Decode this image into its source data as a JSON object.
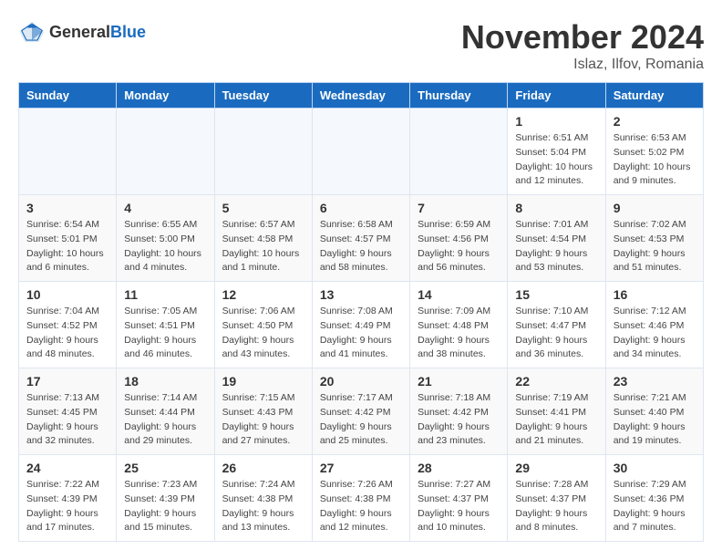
{
  "header": {
    "logo_general": "General",
    "logo_blue": "Blue",
    "month_title": "November 2024",
    "location": "Islaz, Ilfov, Romania"
  },
  "weekdays": [
    "Sunday",
    "Monday",
    "Tuesday",
    "Wednesday",
    "Thursday",
    "Friday",
    "Saturday"
  ],
  "weeks": [
    [
      {
        "day": "",
        "empty": true
      },
      {
        "day": "",
        "empty": true
      },
      {
        "day": "",
        "empty": true
      },
      {
        "day": "",
        "empty": true
      },
      {
        "day": "",
        "empty": true
      },
      {
        "day": "1",
        "sunrise": "Sunrise: 6:51 AM",
        "sunset": "Sunset: 5:04 PM",
        "daylight": "Daylight: 10 hours and 12 minutes."
      },
      {
        "day": "2",
        "sunrise": "Sunrise: 6:53 AM",
        "sunset": "Sunset: 5:02 PM",
        "daylight": "Daylight: 10 hours and 9 minutes."
      }
    ],
    [
      {
        "day": "3",
        "sunrise": "Sunrise: 6:54 AM",
        "sunset": "Sunset: 5:01 PM",
        "daylight": "Daylight: 10 hours and 6 minutes."
      },
      {
        "day": "4",
        "sunrise": "Sunrise: 6:55 AM",
        "sunset": "Sunset: 5:00 PM",
        "daylight": "Daylight: 10 hours and 4 minutes."
      },
      {
        "day": "5",
        "sunrise": "Sunrise: 6:57 AM",
        "sunset": "Sunset: 4:58 PM",
        "daylight": "Daylight: 10 hours and 1 minute."
      },
      {
        "day": "6",
        "sunrise": "Sunrise: 6:58 AM",
        "sunset": "Sunset: 4:57 PM",
        "daylight": "Daylight: 9 hours and 58 minutes."
      },
      {
        "day": "7",
        "sunrise": "Sunrise: 6:59 AM",
        "sunset": "Sunset: 4:56 PM",
        "daylight": "Daylight: 9 hours and 56 minutes."
      },
      {
        "day": "8",
        "sunrise": "Sunrise: 7:01 AM",
        "sunset": "Sunset: 4:54 PM",
        "daylight": "Daylight: 9 hours and 53 minutes."
      },
      {
        "day": "9",
        "sunrise": "Sunrise: 7:02 AM",
        "sunset": "Sunset: 4:53 PM",
        "daylight": "Daylight: 9 hours and 51 minutes."
      }
    ],
    [
      {
        "day": "10",
        "sunrise": "Sunrise: 7:04 AM",
        "sunset": "Sunset: 4:52 PM",
        "daylight": "Daylight: 9 hours and 48 minutes."
      },
      {
        "day": "11",
        "sunrise": "Sunrise: 7:05 AM",
        "sunset": "Sunset: 4:51 PM",
        "daylight": "Daylight: 9 hours and 46 minutes."
      },
      {
        "day": "12",
        "sunrise": "Sunrise: 7:06 AM",
        "sunset": "Sunset: 4:50 PM",
        "daylight": "Daylight: 9 hours and 43 minutes."
      },
      {
        "day": "13",
        "sunrise": "Sunrise: 7:08 AM",
        "sunset": "Sunset: 4:49 PM",
        "daylight": "Daylight: 9 hours and 41 minutes."
      },
      {
        "day": "14",
        "sunrise": "Sunrise: 7:09 AM",
        "sunset": "Sunset: 4:48 PM",
        "daylight": "Daylight: 9 hours and 38 minutes."
      },
      {
        "day": "15",
        "sunrise": "Sunrise: 7:10 AM",
        "sunset": "Sunset: 4:47 PM",
        "daylight": "Daylight: 9 hours and 36 minutes."
      },
      {
        "day": "16",
        "sunrise": "Sunrise: 7:12 AM",
        "sunset": "Sunset: 4:46 PM",
        "daylight": "Daylight: 9 hours and 34 minutes."
      }
    ],
    [
      {
        "day": "17",
        "sunrise": "Sunrise: 7:13 AM",
        "sunset": "Sunset: 4:45 PM",
        "daylight": "Daylight: 9 hours and 32 minutes."
      },
      {
        "day": "18",
        "sunrise": "Sunrise: 7:14 AM",
        "sunset": "Sunset: 4:44 PM",
        "daylight": "Daylight: 9 hours and 29 minutes."
      },
      {
        "day": "19",
        "sunrise": "Sunrise: 7:15 AM",
        "sunset": "Sunset: 4:43 PM",
        "daylight": "Daylight: 9 hours and 27 minutes."
      },
      {
        "day": "20",
        "sunrise": "Sunrise: 7:17 AM",
        "sunset": "Sunset: 4:42 PM",
        "daylight": "Daylight: 9 hours and 25 minutes."
      },
      {
        "day": "21",
        "sunrise": "Sunrise: 7:18 AM",
        "sunset": "Sunset: 4:42 PM",
        "daylight": "Daylight: 9 hours and 23 minutes."
      },
      {
        "day": "22",
        "sunrise": "Sunrise: 7:19 AM",
        "sunset": "Sunset: 4:41 PM",
        "daylight": "Daylight: 9 hours and 21 minutes."
      },
      {
        "day": "23",
        "sunrise": "Sunrise: 7:21 AM",
        "sunset": "Sunset: 4:40 PM",
        "daylight": "Daylight: 9 hours and 19 minutes."
      }
    ],
    [
      {
        "day": "24",
        "sunrise": "Sunrise: 7:22 AM",
        "sunset": "Sunset: 4:39 PM",
        "daylight": "Daylight: 9 hours and 17 minutes."
      },
      {
        "day": "25",
        "sunrise": "Sunrise: 7:23 AM",
        "sunset": "Sunset: 4:39 PM",
        "daylight": "Daylight: 9 hours and 15 minutes."
      },
      {
        "day": "26",
        "sunrise": "Sunrise: 7:24 AM",
        "sunset": "Sunset: 4:38 PM",
        "daylight": "Daylight: 9 hours and 13 minutes."
      },
      {
        "day": "27",
        "sunrise": "Sunrise: 7:26 AM",
        "sunset": "Sunset: 4:38 PM",
        "daylight": "Daylight: 9 hours and 12 minutes."
      },
      {
        "day": "28",
        "sunrise": "Sunrise: 7:27 AM",
        "sunset": "Sunset: 4:37 PM",
        "daylight": "Daylight: 9 hours and 10 minutes."
      },
      {
        "day": "29",
        "sunrise": "Sunrise: 7:28 AM",
        "sunset": "Sunset: 4:37 PM",
        "daylight": "Daylight: 9 hours and 8 minutes."
      },
      {
        "day": "30",
        "sunrise": "Sunrise: 7:29 AM",
        "sunset": "Sunset: 4:36 PM",
        "daylight": "Daylight: 9 hours and 7 minutes."
      }
    ]
  ]
}
